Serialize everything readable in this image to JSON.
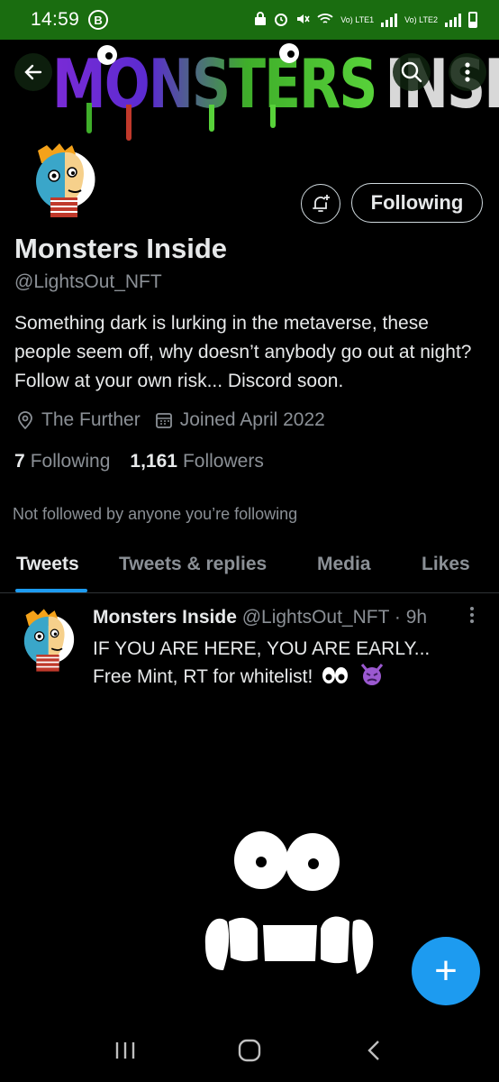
{
  "status_bar": {
    "time": "14:59",
    "b_badge": "B",
    "sim1_label": "Vo) LTE1",
    "sim2_label": "Vo) LTE2"
  },
  "header": {
    "banner_text_1": "MONSTERS",
    "banner_text_2": "INSIDE",
    "icons": [
      "back-arrow-icon",
      "search-icon",
      "more-vertical-icon"
    ]
  },
  "profile": {
    "name": "Monsters Inside",
    "handle": "@LightsOut_NFT",
    "bio": "Something dark is lurking in the metaverse, these people seem off, why doesn’t anybody go out at night? Follow at your own risk... Discord soon.",
    "location": "The Further",
    "joined": "Joined April 2022",
    "following_count": "7",
    "following_label": "Following",
    "followers_count": "1,161",
    "followers_label": "Followers",
    "not_followed": "Not followed by anyone you’re following",
    "follow_button": "Following"
  },
  "tabs": [
    {
      "label": "Tweets",
      "active": true
    },
    {
      "label": "Tweets & replies",
      "active": false
    },
    {
      "label": "Media",
      "active": false
    },
    {
      "label": "Likes",
      "active": false
    }
  ],
  "tweet": {
    "name": "Monsters Inside",
    "handle": "@LightsOut_NFT",
    "separator": "·",
    "time": "9h",
    "line1": "IF YOU ARE HERE, YOU ARE EARLY...",
    "line2": "Free Mint, RT for whitelist!"
  },
  "fab": {
    "label": "+"
  },
  "colors": {
    "accent": "#1d9bf0",
    "status_bar": "#1a6d10",
    "secondary_text": "#8b9096",
    "devil_emoji": "#9b59d0"
  }
}
